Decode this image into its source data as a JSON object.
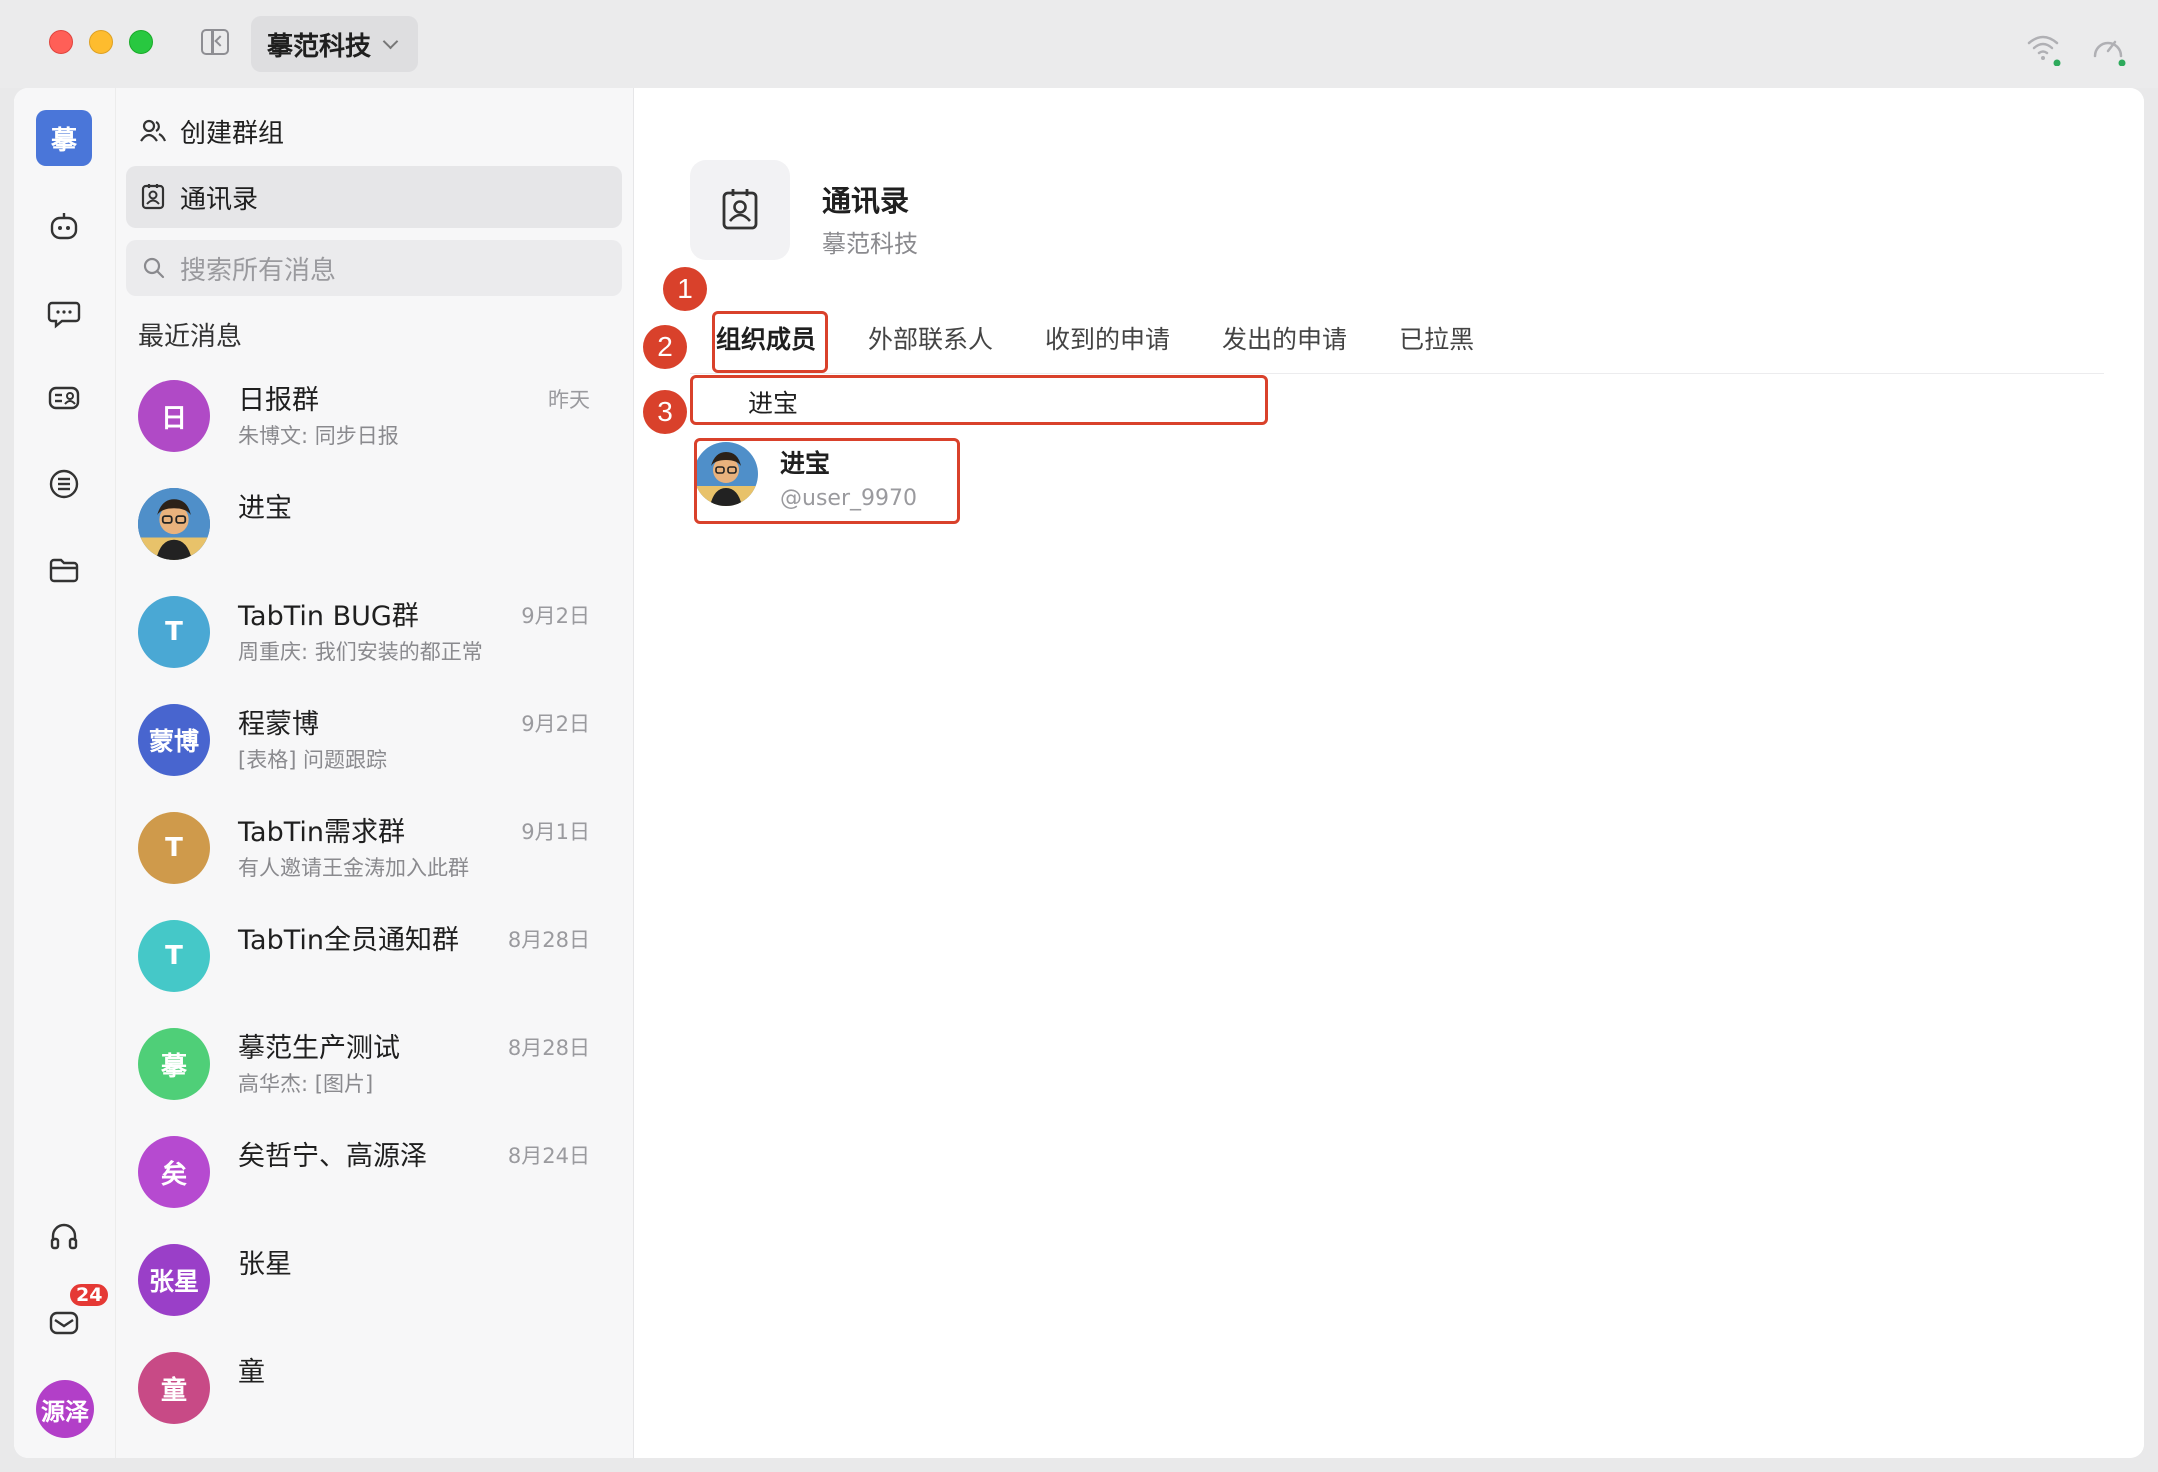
{
  "titlebar": {
    "org_name": "摹范科技"
  },
  "rail": {
    "logo_text": "摹",
    "inbox_badge": "24",
    "user_avatar_text": "源泽"
  },
  "midpanel": {
    "create_group_label": "创建群组",
    "contacts_label": "通讯录",
    "search_placeholder": "搜索所有消息",
    "recent_title": "最近消息",
    "conversations": [
      {
        "name": "日报群",
        "preview": "朱博文: 同步日报",
        "time": "昨天",
        "avatar_text": "日",
        "color": "#b04ac6"
      },
      {
        "name": "进宝",
        "preview": "",
        "time": "",
        "avatar_text": "",
        "color": "#3c6fa8"
      },
      {
        "name": "TabTin BUG群",
        "preview": "周重庆: 我们安装的都正常",
        "time": "9月2日",
        "avatar_text": "T",
        "color": "#4aa8d4"
      },
      {
        "name": "程蒙博",
        "preview": "[表格] 问题跟踪",
        "time": "9月2日",
        "avatar_text": "蒙博",
        "color": "#4865cf"
      },
      {
        "name": "TabTin需求群",
        "preview": "有人邀请王金涛加入此群",
        "time": "9月1日",
        "avatar_text": "T",
        "color": "#cf9a4b"
      },
      {
        "name": "TabTin全员通知群",
        "preview": "",
        "time": "8月28日",
        "avatar_text": "T",
        "color": "#45c8c8"
      },
      {
        "name": "摹范生产测试",
        "preview": "高华杰: [图片]",
        "time": "8月28日",
        "avatar_text": "摹",
        "color": "#4fcf78"
      },
      {
        "name": "矣哲宁、高源泽",
        "preview": "",
        "time": "8月24日",
        "avatar_text": "矣",
        "color": "#b64ad0"
      },
      {
        "name": "张星",
        "preview": "",
        "time": "",
        "avatar_text": "张星",
        "color": "#9a3fc8"
      },
      {
        "name": "童",
        "preview": "",
        "time": "",
        "avatar_text": "童",
        "color": "#c84a86"
      }
    ]
  },
  "main": {
    "title": "通讯录",
    "subtitle": "摹范科技",
    "tabs": [
      "组织成员",
      "外部联系人",
      "收到的申请",
      "发出的申请",
      "已拉黑"
    ],
    "search_value": "进宝",
    "member": {
      "name": "进宝",
      "handle": "@user_9970"
    }
  },
  "annotations": {
    "one": "1",
    "two": "2",
    "three": "3"
  },
  "colors": {
    "annotation_red": "#d9412b",
    "brand_blue": "#4a76d9",
    "badge_red": "#e53935"
  }
}
